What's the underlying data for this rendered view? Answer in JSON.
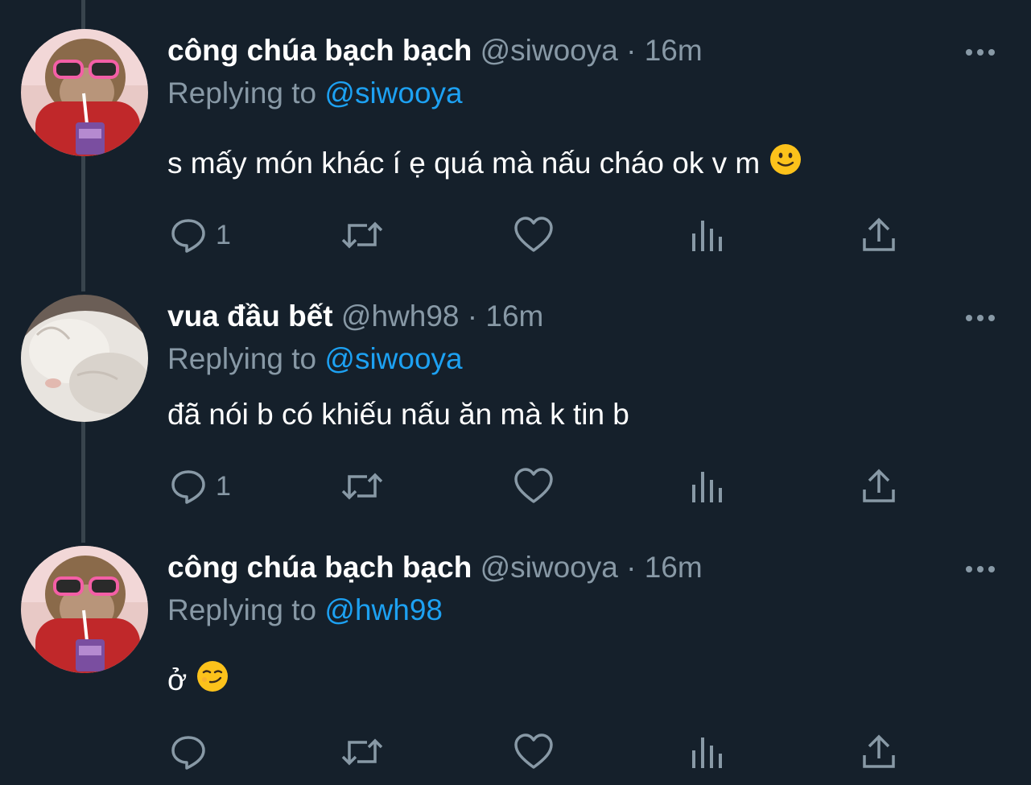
{
  "tweets": [
    {
      "display_name": "công chúa bạch bạch",
      "handle": "@siwooya",
      "separator": "·",
      "time": "16m",
      "replying_prefix": "Replying to",
      "replying_to": "@siwooya",
      "text": "s mấy món khác í ẹ quá mà nấu cháo ok v m",
      "emoji": "slightly-smiling-face",
      "reply_count": "1",
      "avatar": "monkey-avatar"
    },
    {
      "display_name": "vua đầu bết",
      "handle": "@hwh98",
      "separator": "·",
      "time": "16m",
      "replying_prefix": "Replying to",
      "replying_to": "@siwooya",
      "text": "đã nói b có khiếu nấu ăn mà k tin b",
      "emoji": "",
      "reply_count": "1",
      "avatar": "white-cat-avatar"
    },
    {
      "display_name": "công chúa bạch bạch",
      "handle": "@siwooya",
      "separator": "·",
      "time": "16m",
      "replying_prefix": "Replying to",
      "replying_to": "@hwh98",
      "text": "ở",
      "emoji": "smirking-face",
      "reply_count": "",
      "avatar": "monkey-avatar"
    }
  ],
  "icons": {
    "reply": "reply-icon",
    "retweet": "retweet-icon",
    "like": "heart-icon",
    "analytics": "analytics-icon",
    "share": "share-icon",
    "more": "more-icon"
  },
  "colors": {
    "background": "#15202b",
    "text": "#ffffff",
    "secondary": "#8899a6",
    "accent": "#1da1f2",
    "thread_line": "#38444d"
  }
}
